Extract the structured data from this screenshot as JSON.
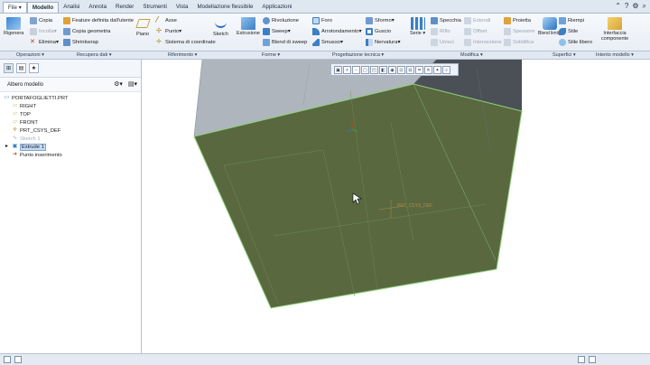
{
  "menubar": {
    "tabs": [
      "File",
      "Modello",
      "Analisi",
      "Annota",
      "Render",
      "Strumenti",
      "Vista",
      "Modellazione flessibile",
      "Applicazioni"
    ],
    "active_tab": "Modello"
  },
  "ribbon": {
    "rigenera": "Rigenera",
    "copia": "Copia",
    "incolla": "Incolla",
    "elimina": "Elimina",
    "feature_utente": "Feature definita dall'utente",
    "copia_geometria": "Copia geometria",
    "shrinkwrap": "Shrinkwrap",
    "piano": "Piano",
    "asse": "Asse",
    "punto": "Punto",
    "sistema_coordinate": "Sistema di coordinate",
    "sketch": "Sketch",
    "estrusione": "Estrusione",
    "rivoluzione": "Rivoluzione",
    "sweep": "Sweep",
    "blend_sweep": "Blend di sweep",
    "foro": "Foro",
    "arrotondamento": "Arrotondamento",
    "smusso": "Smusso",
    "sformo": "Sformo",
    "guscio": "Guscio",
    "nervatura": "Nervatura",
    "serie": "Serie",
    "specchia": "Specchia",
    "estendi": "Estendi",
    "riflo": "Riflo",
    "offset": "Offset",
    "unisci": "Unisci",
    "intersezione": "Intersezione",
    "proietta": "Proietta",
    "spessore": "Spessore",
    "solidifica": "Solidifica",
    "blend_limite": "Blend limite",
    "riempi": "Riempi",
    "stile": "Stile",
    "stile_libero": "Stile libero",
    "interfaccia_componente": "Interfaccia componente"
  },
  "groups": [
    "Operazioni",
    "Recupera dati",
    "Riferimento",
    "Forme",
    "Progettazione tecnica",
    "Modifica",
    "Superfici",
    "Intento modello"
  ],
  "left_panel": {
    "title": "Albero modello",
    "items": [
      {
        "label": "PORTAFOGLIETTI.PRT",
        "icon": "part-icon",
        "dim": false,
        "selected": false,
        "indent": 0
      },
      {
        "label": "RIGHT",
        "icon": "datum-plane-icon",
        "dim": false,
        "selected": false,
        "indent": 1
      },
      {
        "label": "TOP",
        "icon": "datum-plane-icon",
        "dim": false,
        "selected": false,
        "indent": 1
      },
      {
        "label": "FRONT",
        "icon": "datum-plane-icon",
        "dim": false,
        "selected": false,
        "indent": 1
      },
      {
        "label": "PRT_CSYS_DEF",
        "icon": "csys-icon",
        "dim": false,
        "selected": false,
        "indent": 1
      },
      {
        "label": "Sketch 1",
        "icon": "sketch-icon",
        "dim": true,
        "selected": false,
        "indent": 1
      },
      {
        "label": "Extrude 1",
        "icon": "extrude-icon",
        "dim": false,
        "selected": true,
        "indent": 1
      },
      {
        "label": "Punto inserimento",
        "icon": "insert-arrow-icon",
        "dim": false,
        "selected": false,
        "indent": 1
      }
    ]
  },
  "viewport": {
    "csys_label": "PRT_CSYS_DEF",
    "colors": {
      "top_face": "#5a6b3f",
      "side_face": "#a8b0b8",
      "dark_face": "#4a4f55",
      "edge": "#7ec86a"
    }
  }
}
